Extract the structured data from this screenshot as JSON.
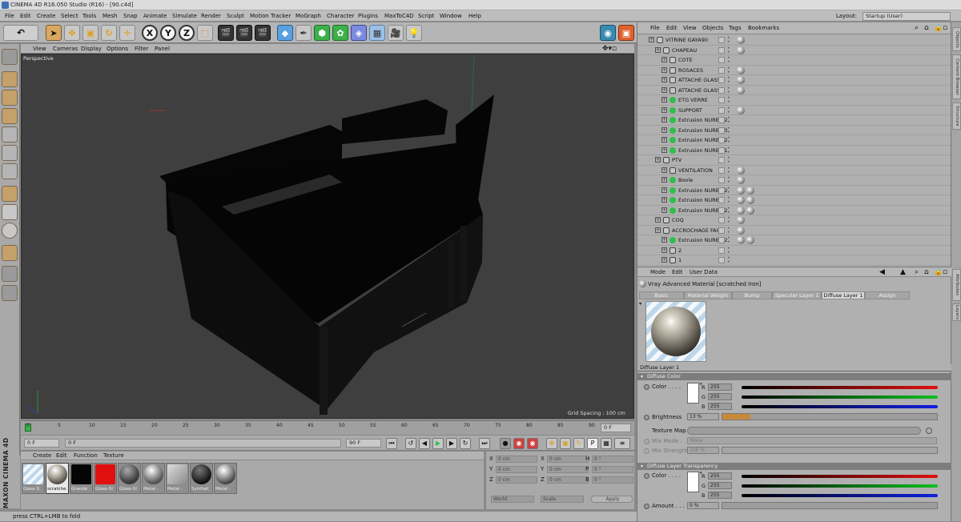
{
  "window": {
    "title": "CINEMA 4D R16.050 Studio (R16) - [90.c4d]"
  },
  "menu": [
    "File",
    "Edit",
    "Create",
    "Select",
    "Tools",
    "Mesh",
    "Snap",
    "Animate",
    "Simulate",
    "Render",
    "Sculpt",
    "Motion Tracker",
    "MoGraph",
    "Character",
    "Plugins",
    "MaxToC4D",
    "Script",
    "Window",
    "Help"
  ],
  "layout": {
    "label": "Layout:",
    "value": "Startup (User)"
  },
  "viewport": {
    "menu": [
      "View",
      "Cameras",
      "Display",
      "Options",
      "Filter",
      "Panel"
    ],
    "label": "Perspective",
    "grid_spacing": "Grid Spacing : 100 cm"
  },
  "timeline": {
    "ticks": [
      "0",
      "5",
      "10",
      "15",
      "20",
      "25",
      "30",
      "35",
      "40",
      "45",
      "50",
      "55",
      "60",
      "65",
      "70",
      "75",
      "80",
      "85",
      "90"
    ],
    "end_frame": "0 F",
    "current": "0 F",
    "range_start": "0 F",
    "range_end": "90 F",
    "max": "90 F"
  },
  "materials": {
    "menu": [
      "Create",
      "Edit",
      "Function",
      "Texture"
    ],
    "items": [
      {
        "label": "Glass S",
        "color": "glass"
      },
      {
        "label": "scratche",
        "color": "metal"
      },
      {
        "label": "Grande",
        "color": "black"
      },
      {
        "label": "Glass-Sl",
        "color": "red"
      },
      {
        "label": "Glass-Sl",
        "color": "dark-metal"
      },
      {
        "label": "Metal -",
        "color": "metal"
      },
      {
        "label": "Metal -",
        "color": "metal-light"
      },
      {
        "label": "Synthet",
        "color": "dark"
      },
      {
        "label": "Metal -",
        "color": "metal"
      }
    ]
  },
  "coords": {
    "rows": [
      {
        "axis": "X",
        "v1": "0 cm",
        "axis2": "X",
        "v2": "0 cm",
        "axis3": "H",
        "v3": "0 °"
      },
      {
        "axis": "Y",
        "v1": "0 cm",
        "axis2": "Y",
        "v2": "0 cm",
        "axis3": "P",
        "v3": "0 °"
      },
      {
        "axis": "Z",
        "v1": "0 cm",
        "axis2": "Z",
        "v2": "0 cm",
        "axis3": "B",
        "v3": "0 °"
      }
    ],
    "mode1": "World",
    "mode2": "Scale",
    "apply": "Apply"
  },
  "status": "press CTRL+LMB to fold",
  "objects": {
    "menu": [
      "File",
      "Edit",
      "View",
      "Objects",
      "Tags",
      "Bookmarks"
    ],
    "rows": [
      {
        "name": "VITRINE GAYA90",
        "indent": 0,
        "type": "null",
        "tags": 1
      },
      {
        "name": "CHAPEAU",
        "indent": 1,
        "type": "null",
        "tags": 1
      },
      {
        "name": "COTE",
        "indent": 2,
        "type": "null",
        "tags": 0
      },
      {
        "name": "ROSACES",
        "indent": 2,
        "type": "null",
        "tags": 1
      },
      {
        "name": "ATTACHE GLASS 2",
        "indent": 2,
        "type": "null",
        "tags": 1
      },
      {
        "name": "ATTACHE GLASS",
        "indent": 2,
        "type": "null",
        "tags": 1
      },
      {
        "name": "ETG VERRE",
        "indent": 2,
        "type": "green",
        "tags": 0
      },
      {
        "name": "SUPPORT",
        "indent": 2,
        "type": "green",
        "tags": 1
      },
      {
        "name": "Extrusion NURBS.2",
        "indent": 2,
        "type": "green",
        "tags": 0
      },
      {
        "name": "Extrusion NURBS.3",
        "indent": 2,
        "type": "green",
        "tags": 0
      },
      {
        "name": "Extrusion NURBS.2",
        "indent": 2,
        "type": "green",
        "tags": 0
      },
      {
        "name": "Extrusion NURBS.1",
        "indent": 2,
        "type": "green",
        "tags": 0
      },
      {
        "name": "PTV",
        "indent": 1,
        "type": "null",
        "tags": 0
      },
      {
        "name": "VENTILATION",
        "indent": 2,
        "type": "null",
        "tags": 1
      },
      {
        "name": "Boole",
        "indent": 2,
        "type": "green",
        "tags": 1
      },
      {
        "name": "Extrusion NURBS.2",
        "indent": 2,
        "type": "green",
        "tags": 2
      },
      {
        "name": "Extrusion NURBS",
        "indent": 2,
        "type": "green",
        "tags": 2
      },
      {
        "name": "Extrusion NURBS.2",
        "indent": 2,
        "type": "green",
        "tags": 2
      },
      {
        "name": "COQ",
        "indent": 1,
        "type": "null",
        "tags": 1
      },
      {
        "name": "ACCROCHAGE FACD",
        "indent": 1,
        "type": "null",
        "tags": 1
      },
      {
        "name": "Extrusion NURBS.2",
        "indent": 2,
        "type": "green",
        "tags": 2
      },
      {
        "name": "2",
        "indent": 2,
        "type": "null",
        "tags": 0
      },
      {
        "name": "1",
        "indent": 2,
        "type": "null",
        "tags": 0
      }
    ]
  },
  "attributes": {
    "menu": [
      "Mode",
      "Edit",
      "User Data"
    ],
    "material_title": "Vray Advanced Material [scratched Iron]",
    "tabs": [
      "Basic",
      "Material Weight",
      "Bump",
      "Specular Layer 1",
      "Diffuse Layer 1",
      "Assign"
    ],
    "active_tab": "Diffuse Layer 1",
    "section1": "Diffuse Layer 1",
    "subsection1": "Diffuse Color",
    "color_label": "Color . . . .",
    "r_label": "R",
    "g_label": "G",
    "b_label": "B",
    "r": "255",
    "g": "255",
    "b": "255",
    "brightness_label": "Brightness",
    "brightness": "13 %",
    "brightness_level": 0.13,
    "texture_map_label": "Texture Map",
    "mix_mode_label": "Mix Mode . . .",
    "mix_mode": "None",
    "mix_strength_label": "Mix Strength",
    "mix_strength": "100 %",
    "subsection2": "Diffuse Layer Transparency",
    "color2_label": "Color . . . .",
    "r2": "255",
    "g2": "255",
    "b2": "255",
    "amount_label": "Amount . . .",
    "amount": "0 %",
    "amount_level": 0.0
  },
  "right_tabs": [
    "Objects",
    "Content Browser",
    "Structure",
    "Attributes",
    "Layers"
  ],
  "colors": {
    "accent": "#c88a3a",
    "green": "#2fbf4a"
  }
}
